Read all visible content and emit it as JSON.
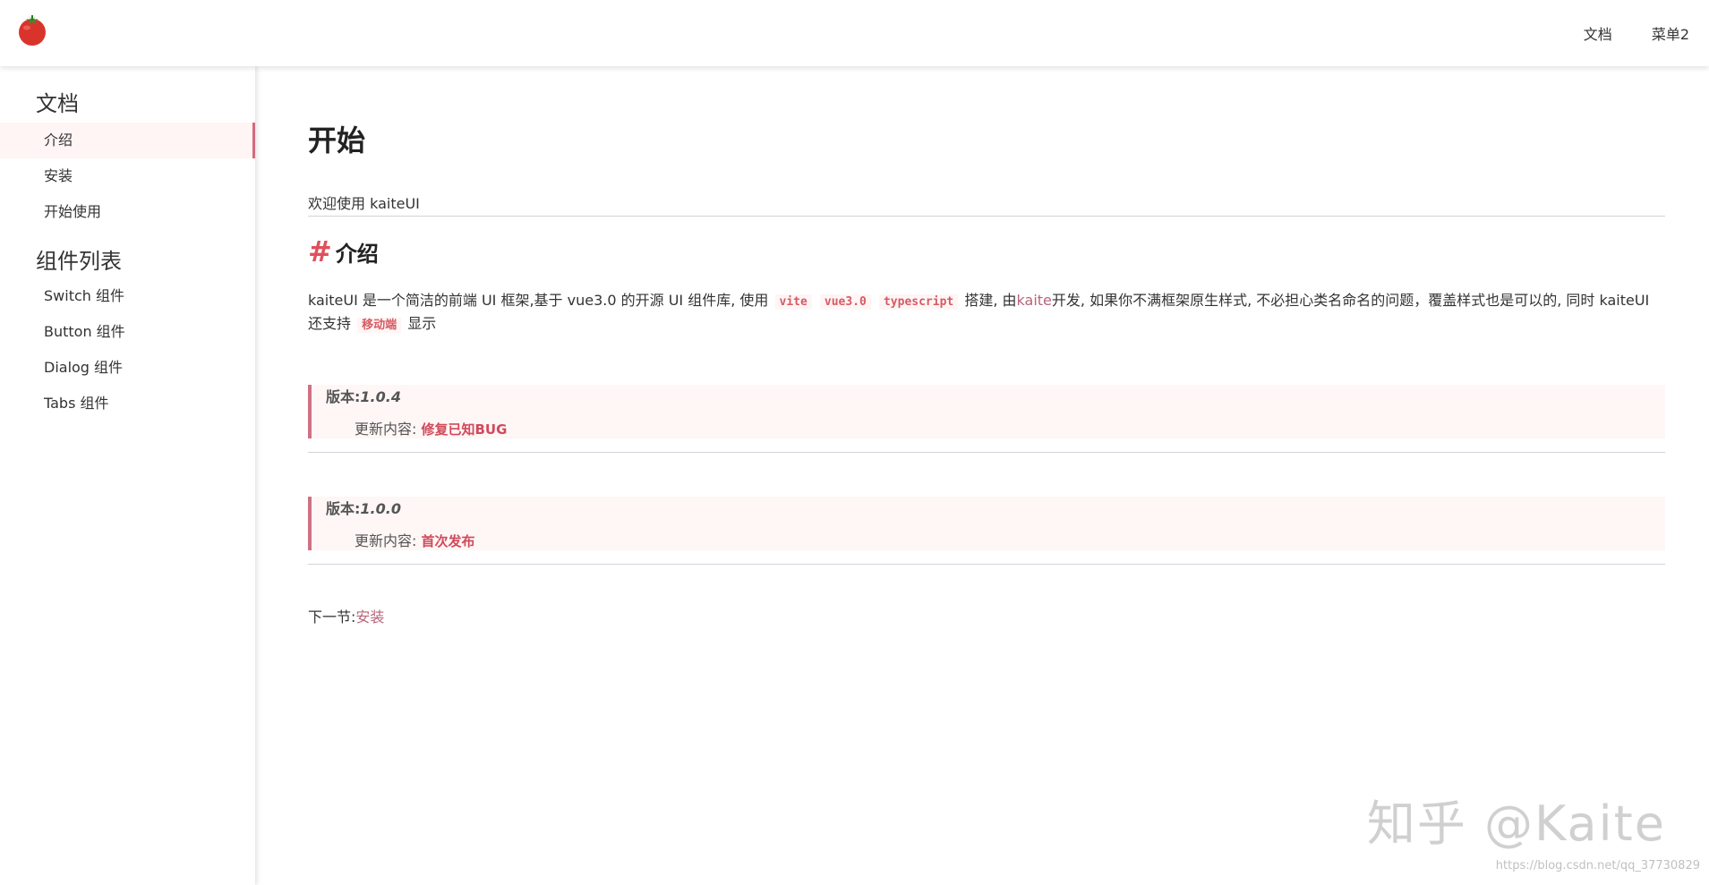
{
  "header": {
    "logo_icon": "tomato-icon",
    "menu": [
      {
        "label": "文档"
      },
      {
        "label": "菜单2"
      }
    ]
  },
  "sidebar": {
    "groups": [
      {
        "title": "文档",
        "items": [
          {
            "label": "介绍",
            "active": true
          },
          {
            "label": "安装"
          },
          {
            "label": "开始使用"
          }
        ]
      },
      {
        "title": "组件列表",
        "items": [
          {
            "label": "Switch 组件"
          },
          {
            "label": "Button 组件"
          },
          {
            "label": "Dialog 组件"
          },
          {
            "label": "Tabs 组件"
          }
        ]
      }
    ]
  },
  "main": {
    "title": "开始",
    "welcome": "欢迎使用 kaiteUI",
    "section": {
      "hash": "#",
      "heading": "介绍"
    },
    "intro": {
      "part1": "kaiteUI 是一个简洁的前端 UI 框架,基于 vue3.0 的开源 UI 组件库, 使用",
      "code1": "vite",
      "code2": "vue3.0",
      "code3": "typescript",
      "part2": "搭建, 由",
      "author_link": "kaite",
      "part3": "开发, 如果你不满框架原生样式, 不必担心类名命名的问题，覆盖样式也是可以的, 同时 kaiteUI 还支持",
      "mobile": "移动端",
      "part4": "显示"
    },
    "versions": [
      {
        "label": "版本:",
        "number": "1.0.4",
        "update_label": "更新内容:",
        "update_value": "修复已知BUG"
      },
      {
        "label": "版本:",
        "number": "1.0.0",
        "update_label": "更新内容:",
        "update_value": "首次发布"
      }
    ],
    "next": {
      "label": "下一节:",
      "link": "安装"
    }
  },
  "watermark": {
    "text": "知乎 @Kaite",
    "url": "https://blog.csdn.net/qq_37730829"
  },
  "colors": {
    "accent": "#d46a7e",
    "code_text": "#d65a63",
    "hash": "#e0505c",
    "block_bg": "#fff6f6"
  }
}
